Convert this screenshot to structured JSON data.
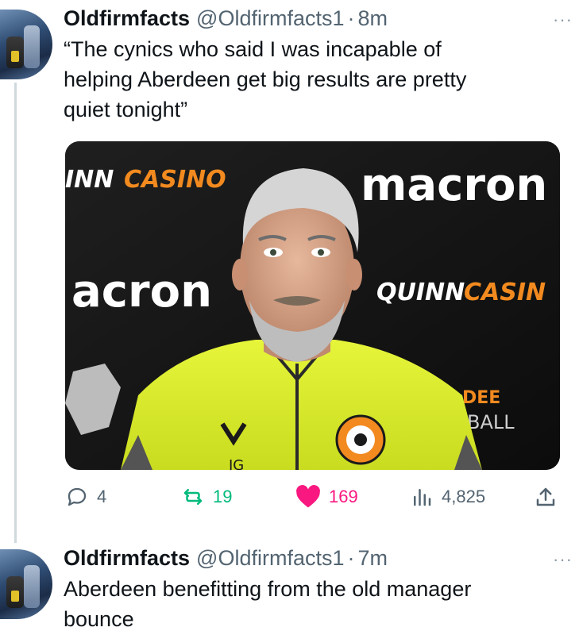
{
  "tweets": [
    {
      "name": "Oldfirmfacts",
      "handle": "@Oldfirmfacts1",
      "separator": "·",
      "time": "8m",
      "text_lines": [
        "“The cynics who said I was incapable of",
        "helping Aberdeen get big results are pretty",
        "quiet tonight”"
      ],
      "more_icon": "···",
      "media": {
        "alt": "photo",
        "banner_texts": [
          "INN",
          "CASINO",
          "macron",
          "acron",
          "QUINN",
          "CASIN",
          "DEE",
          "BALL",
          "IG"
        ]
      },
      "actions": {
        "replies": "4",
        "retweets": "19",
        "likes": "169",
        "views": "4,825"
      }
    },
    {
      "name": "Oldfirmfacts",
      "handle": "@Oldfirmfacts1",
      "separator": "·",
      "time": "7m",
      "text_lines": [
        "Aberdeen benefitting from the old manager",
        "bounce"
      ],
      "more_icon": "···"
    }
  ],
  "colors": {
    "retweet": "#00ba7c",
    "like": "#f91880",
    "muted": "#536471"
  }
}
